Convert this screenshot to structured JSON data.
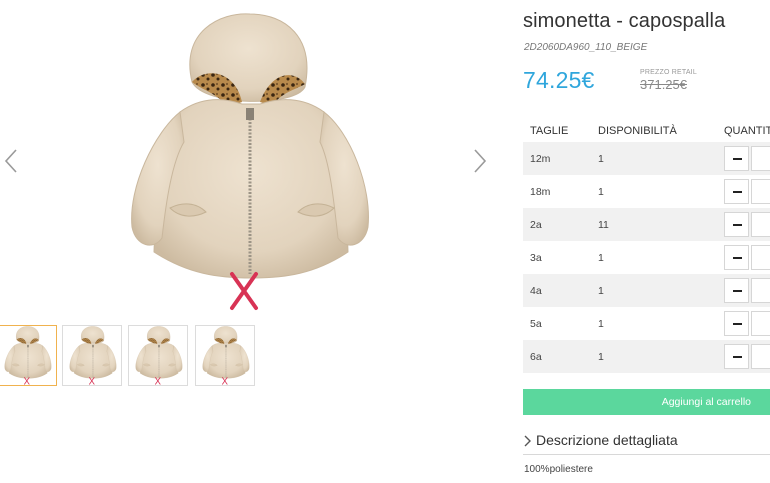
{
  "product": {
    "title": "simonetta - capospalla",
    "sku": "2D2060DA960_110_BEIGE",
    "price": "74.25€",
    "retail_label": "PREZZO RETAIL",
    "retail_price": "371.25€"
  },
  "table": {
    "headers": {
      "size": "TAGLIE",
      "availability": "DISPONIBILITÀ",
      "quantity": "QUANTITÀ"
    },
    "rows": [
      {
        "size": "12m",
        "availability": "1"
      },
      {
        "size": "18m",
        "availability": "1"
      },
      {
        "size": "2a",
        "availability": "11"
      },
      {
        "size": "3a",
        "availability": "1"
      },
      {
        "size": "4a",
        "availability": "1"
      },
      {
        "size": "5a",
        "availability": "1"
      },
      {
        "size": "6a",
        "availability": "1"
      }
    ]
  },
  "cart_button": {
    "label": "Aggiungi al carrello"
  },
  "description": {
    "toggle_label": "Descrizione dettagliata",
    "material": "100%poliestere"
  },
  "gallery": {
    "thumbnail_count": 4,
    "active_thumbnail": 1
  },
  "colors": {
    "accent_price": "#2fa6dc",
    "cart_green": "#5bd79d",
    "active_thumb_border": "#f0b24e",
    "ribbon_red": "#d83355"
  }
}
